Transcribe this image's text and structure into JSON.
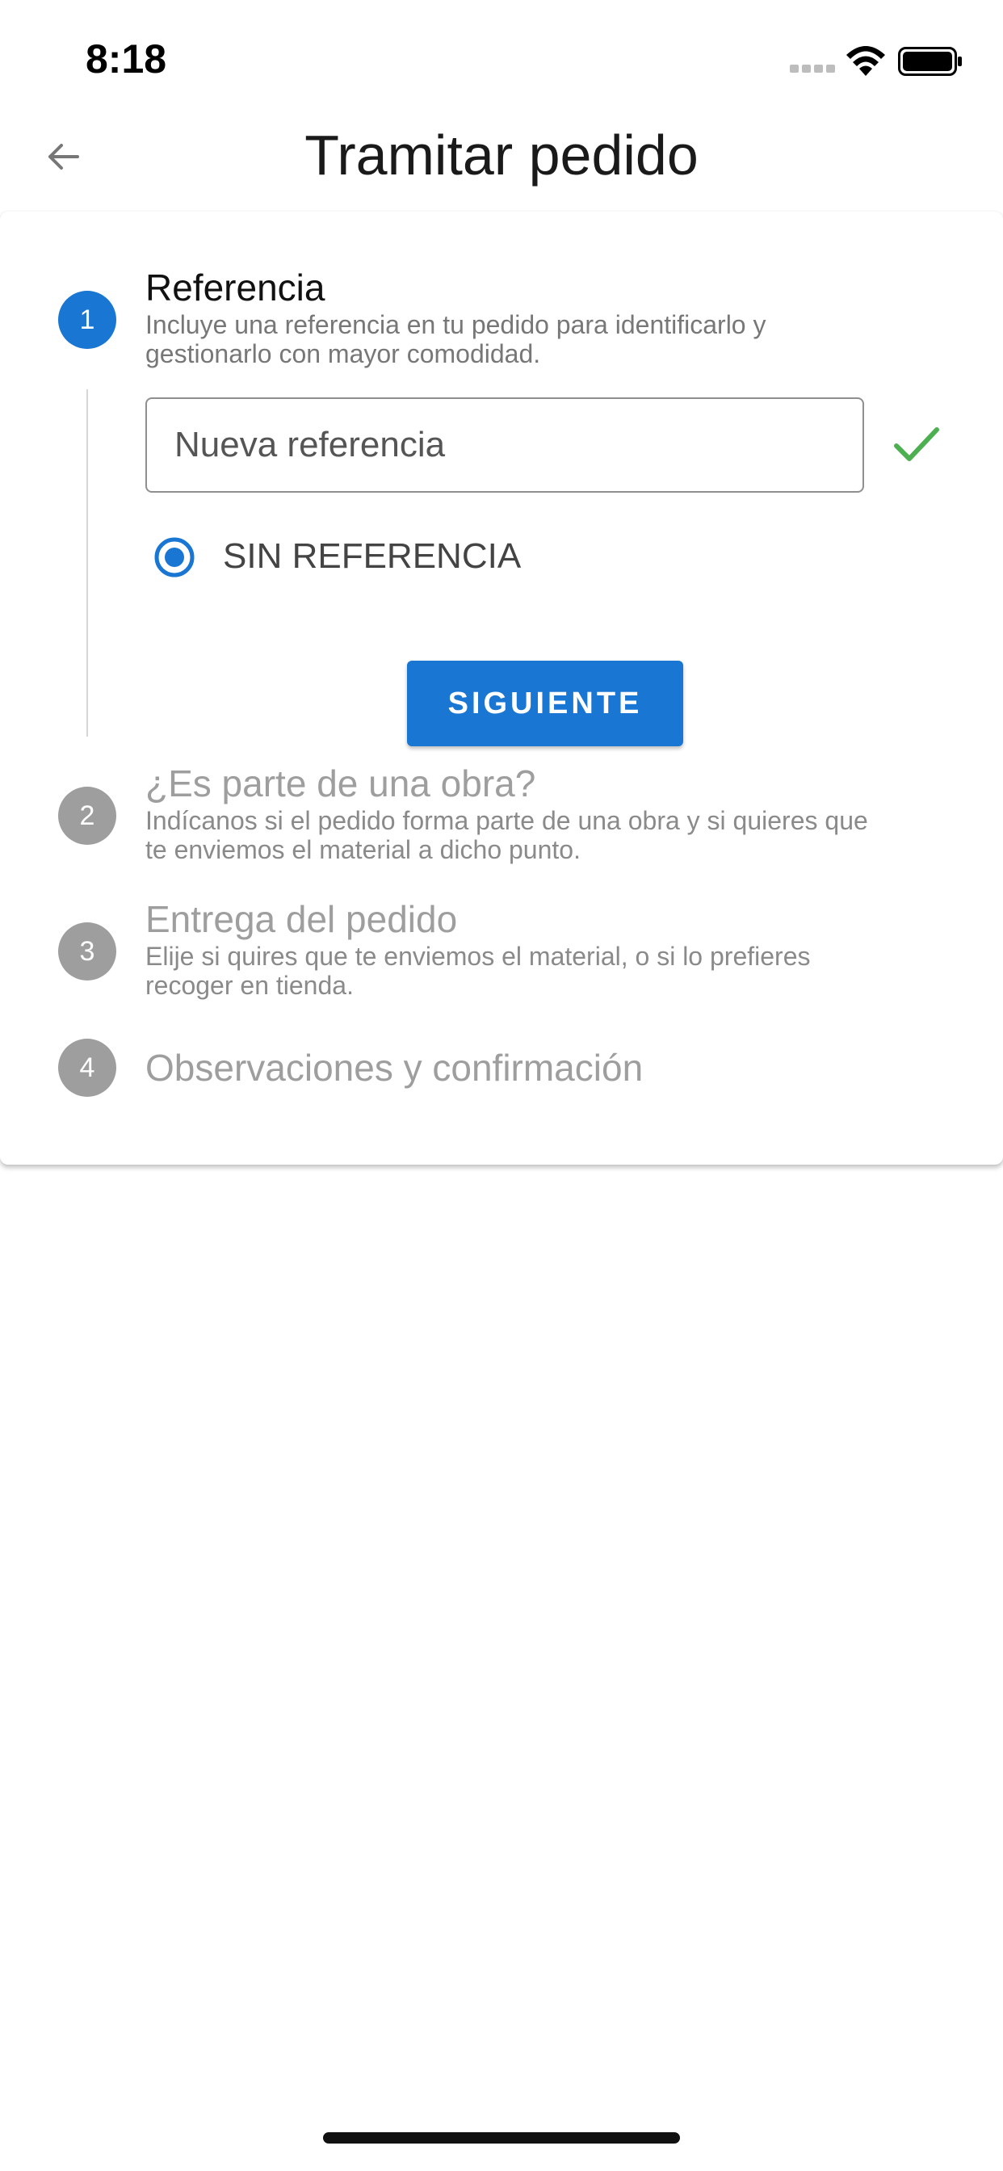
{
  "status_bar": {
    "time": "8:18"
  },
  "header": {
    "title": "Tramitar pedido",
    "back_icon": "arrow-left-icon"
  },
  "steps": [
    {
      "number": "1",
      "title": "Referencia",
      "subtitle_line1": "Incluye una referencia en tu pedido para identificarlo y",
      "subtitle_line2": "gestionarlo con mayor comodidad.",
      "state": "active"
    },
    {
      "number": "2",
      "title": "¿Es parte de una obra?",
      "subtitle_line1": "Indícanos si el pedido forma parte de una obra y si quieres que",
      "subtitle_line2": "te enviemos el material a dicho punto.",
      "state": "inactive"
    },
    {
      "number": "3",
      "title": "Entrega del pedido",
      "subtitle_line1": "Elije si quires que te enviemos el material, o si lo prefieres",
      "subtitle_line2": "recoger en tienda.",
      "state": "inactive"
    },
    {
      "number": "4",
      "title": "Observaciones y confirmación",
      "state": "inactive"
    }
  ],
  "reference_form": {
    "input_placeholder": "Nueva referencia",
    "input_value": "",
    "radio_label": "SIN REFERENCIA",
    "radio_selected": true,
    "next_label": "SIGUIENTE"
  },
  "colors": {
    "primary": "#1976d2",
    "inactive": "#9e9e9e",
    "success": "#4caf50"
  }
}
